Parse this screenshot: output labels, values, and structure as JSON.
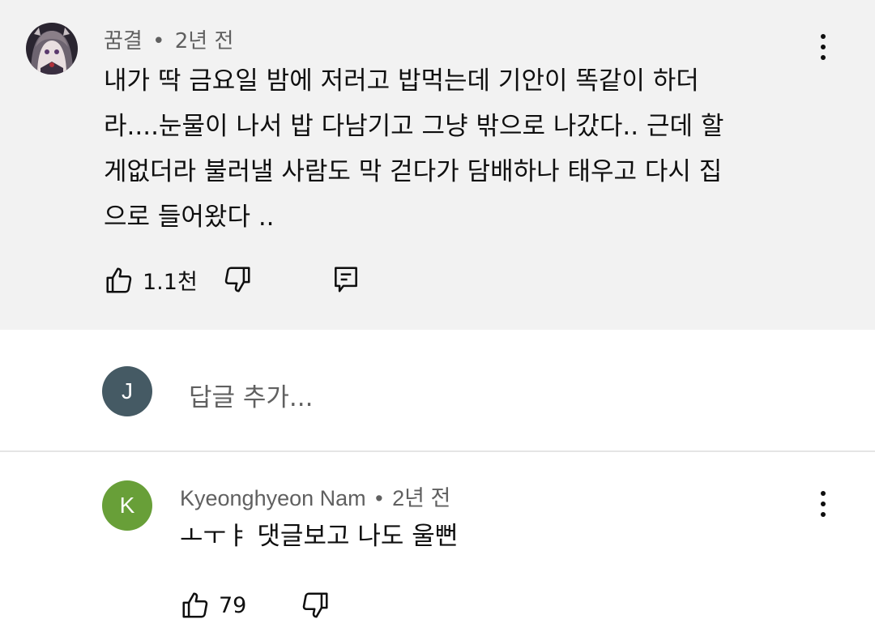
{
  "comment": {
    "author": "꿈결",
    "time": "2년 전",
    "lines": [
      "내가 딱 금요일 밤에 저러고 밥먹는데 기안이 똑같이 하더",
      "라....눈물이 나서 밥 다남기고 그냥 밖으로 나갔다.. 근데 할",
      "게없더라 불러낼 사람도 막 걷다가 담배하나 태우고 다시 집",
      "으로 들어왔다 .."
    ],
    "like_count": "1.1천"
  },
  "reply_input": {
    "avatar_letter": "J",
    "placeholder": "답글 추가..."
  },
  "reply": {
    "avatar_letter": "K",
    "author": "Kyeonghyeon Nam",
    "time": "2년 전",
    "text": "ㅗㅜㅑ 댓글보고 나도 울뻔",
    "like_count": "79"
  },
  "separator": "•",
  "colors": {
    "highlight_bg": "#f2f2f2",
    "avatar_j": "#455a64",
    "avatar_k": "#689f38",
    "secondary_text": "#606060"
  }
}
